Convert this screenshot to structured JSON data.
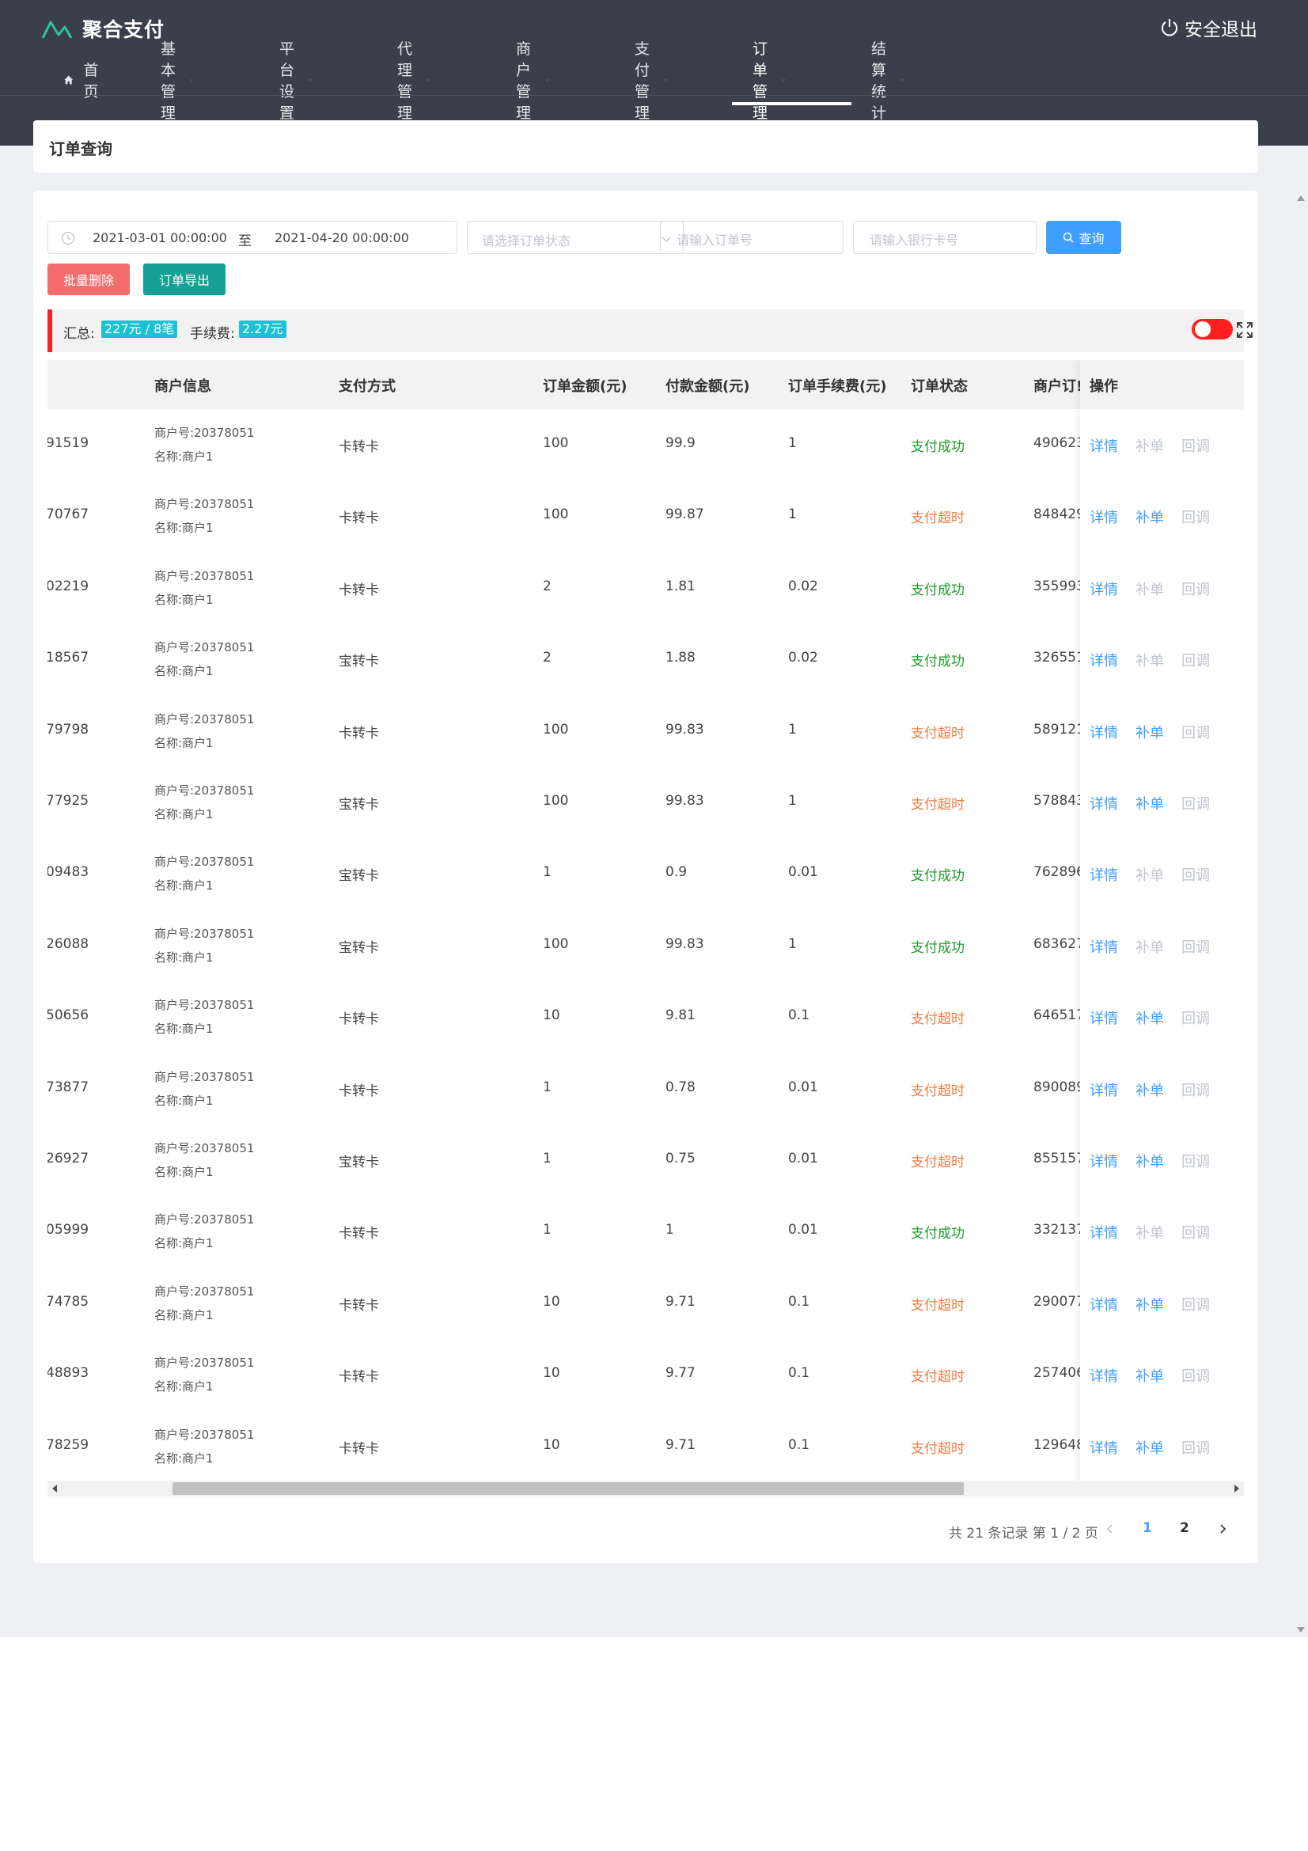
{
  "app": {
    "title": "聚合支付",
    "logout_label": "安全退出"
  },
  "nav": [
    {
      "label": "首页",
      "has_dropdown": false,
      "icon": "home-icon"
    },
    {
      "label": "基本管理",
      "has_dropdown": true
    },
    {
      "label": "平台设置",
      "has_dropdown": true
    },
    {
      "label": "代理管理",
      "has_dropdown": true
    },
    {
      "label": "商户管理",
      "has_dropdown": true
    },
    {
      "label": "支付管理",
      "has_dropdown": true
    },
    {
      "label": "订单管理",
      "has_dropdown": true,
      "active": true
    },
    {
      "label": "结算统计",
      "has_dropdown": true
    }
  ],
  "page_title": "订单查询",
  "filters": {
    "date_start": "2021-03-01 00:00:00",
    "date_sep": "至",
    "date_end": "2021-04-20 00:00:00",
    "status_placeholder": "请选择订单状态",
    "order_placeholder": "请输入订单号",
    "bank_placeholder": "请输入银行卡号",
    "query_label": "查询"
  },
  "actions": {
    "batch_delete": "批量删除",
    "export": "订单导出"
  },
  "summary": {
    "total_label": "汇总:",
    "total_value": "227元 / 8笔",
    "fee_label": "手续费:",
    "fee_value": "2.27元"
  },
  "table": {
    "headers": {
      "merchant_info": "商户信息",
      "pay_method": "支付方式",
      "order_amount": "订单金额(元)",
      "paid_amount": "付款金额(元)",
      "fee": "订单手续费(元)",
      "status": "订单状态",
      "merchant_order": "商户订!",
      "ops": "操作"
    },
    "rows": [
      {
        "id": "91519",
        "mer_no": "商户号:20378051",
        "mer_name": "名称:商户1",
        "method": "卡转卡",
        "amount": "100",
        "paid": "99.9",
        "fee": "1",
        "status": "支付成功",
        "ok": true,
        "mer_order": "490623"
      },
      {
        "id": "70767",
        "mer_no": "商户号:20378051",
        "mer_name": "名称:商户1",
        "method": "卡转卡",
        "amount": "100",
        "paid": "99.87",
        "fee": "1",
        "status": "支付超时",
        "ok": false,
        "mer_order": "848429"
      },
      {
        "id": "02219",
        "mer_no": "商户号:20378051",
        "mer_name": "名称:商户1",
        "method": "卡转卡",
        "amount": "2",
        "paid": "1.81",
        "fee": "0.02",
        "status": "支付成功",
        "ok": true,
        "mer_order": "355993"
      },
      {
        "id": "18567",
        "mer_no": "商户号:20378051",
        "mer_name": "名称:商户1",
        "method": "宝转卡",
        "amount": "2",
        "paid": "1.88",
        "fee": "0.02",
        "status": "支付成功",
        "ok": true,
        "mer_order": "326551"
      },
      {
        "id": "79798",
        "mer_no": "商户号:20378051",
        "mer_name": "名称:商户1",
        "method": "卡转卡",
        "amount": "100",
        "paid": "99.83",
        "fee": "1",
        "status": "支付超时",
        "ok": false,
        "mer_order": "589121"
      },
      {
        "id": "77925",
        "mer_no": "商户号:20378051",
        "mer_name": "名称:商户1",
        "method": "宝转卡",
        "amount": "100",
        "paid": "99.83",
        "fee": "1",
        "status": "支付超时",
        "ok": false,
        "mer_order": "578843"
      },
      {
        "id": "09483",
        "mer_no": "商户号:20378051",
        "mer_name": "名称:商户1",
        "method": "宝转卡",
        "amount": "1",
        "paid": "0.9",
        "fee": "0.01",
        "status": "支付成功",
        "ok": true,
        "mer_order": "762896"
      },
      {
        "id": "26088",
        "mer_no": "商户号:20378051",
        "mer_name": "名称:商户1",
        "method": "宝转卡",
        "amount": "100",
        "paid": "99.83",
        "fee": "1",
        "status": "支付成功",
        "ok": true,
        "mer_order": "683627"
      },
      {
        "id": "50656",
        "mer_no": "商户号:20378051",
        "mer_name": "名称:商户1",
        "method": "卡转卡",
        "amount": "10",
        "paid": "9.81",
        "fee": "0.1",
        "status": "支付超时",
        "ok": false,
        "mer_order": "646517"
      },
      {
        "id": "73877",
        "mer_no": "商户号:20378051",
        "mer_name": "名称:商户1",
        "method": "卡转卡",
        "amount": "1",
        "paid": "0.78",
        "fee": "0.01",
        "status": "支付超时",
        "ok": false,
        "mer_order": "890089"
      },
      {
        "id": "26927",
        "mer_no": "商户号:20378051",
        "mer_name": "名称:商户1",
        "method": "宝转卡",
        "amount": "1",
        "paid": "0.75",
        "fee": "0.01",
        "status": "支付超时",
        "ok": false,
        "mer_order": "855157"
      },
      {
        "id": "05999",
        "mer_no": "商户号:20378051",
        "mer_name": "名称:商户1",
        "method": "卡转卡",
        "amount": "1",
        "paid": "1",
        "fee": "0.01",
        "status": "支付成功",
        "ok": true,
        "mer_order": "332137"
      },
      {
        "id": "74785",
        "mer_no": "商户号:20378051",
        "mer_name": "名称:商户1",
        "method": "卡转卡",
        "amount": "10",
        "paid": "9.71",
        "fee": "0.1",
        "status": "支付超时",
        "ok": false,
        "mer_order": "290077"
      },
      {
        "id": "48893",
        "mer_no": "商户号:20378051",
        "mer_name": "名称:商户1",
        "method": "卡转卡",
        "amount": "10",
        "paid": "9.77",
        "fee": "0.1",
        "status": "支付超时",
        "ok": false,
        "mer_order": "257406"
      },
      {
        "id": "78259",
        "mer_no": "商户号:20378051",
        "mer_name": "名称:商户1",
        "method": "卡转卡",
        "amount": "10",
        "paid": "9.71",
        "fee": "0.1",
        "status": "支付超时",
        "ok": false,
        "mer_order": "129648"
      }
    ],
    "ops": {
      "detail": "详情",
      "supplement": "补单",
      "callback": "回调"
    }
  },
  "pagination": {
    "summary": "共 21 条记录 第 1 / 2 页",
    "pages": [
      "1",
      "2"
    ],
    "current": "1"
  },
  "colors": {
    "header_bg": "#3a3f4b",
    "primary": "#409eff",
    "success": "#1f9b2a",
    "timeout": "#f07b3f",
    "danger": "#f56c6c",
    "teal": "#17a094",
    "tag": "#1cc1d4",
    "marker": "#ff1f1f"
  }
}
